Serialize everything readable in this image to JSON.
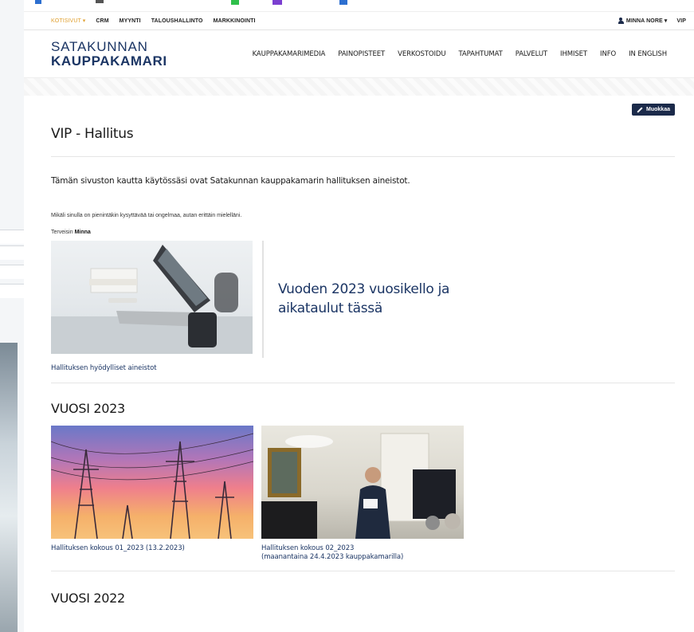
{
  "admin_bar": {
    "items": [
      "KOTISIVUT ▾",
      "CRM",
      "MYYNTI",
      "TALOUSHALLINTO",
      "MARKKINOINTI"
    ],
    "user": "MINNA NORE ▾",
    "vip": "VIP"
  },
  "logo": {
    "line1": "SATAKUNNAN",
    "line2": "KAUPPAKAMARI"
  },
  "nav": [
    "KAUPPAKAMARIMEDIA",
    "PAINOPISTEET",
    "VERKOSTOIDU",
    "TAPAHTUMAT",
    "PALVELUT",
    "IHMISET",
    "INFO",
    "IN ENGLISH"
  ],
  "edit_button": "Muokkaa",
  "page_title": "VIP - Hallitus",
  "intro": "Tämän sivuston kautta käytössäsi ovat Satakunnan kauppakamarin hallituksen aineistot.",
  "help_text": "Mikäli sinulla on pienintäkin kysyttävää tai ongelmaa, autan erittäin mielelläni.",
  "greeting": {
    "prefix": "Terveisin ",
    "name": "Minna"
  },
  "feature": {
    "text": "Vuoden 2023 vuosikello ja aikataulut tässä",
    "caption": "Hallituksen hyödylliset aineistot"
  },
  "years": [
    {
      "title": "VUOSI 2023",
      "cards": [
        {
          "caption": "Hallituksen kokous 01_2023 (13.2.2023)"
        },
        {
          "caption_line1": "Hallituksen kokous 02_2023",
          "caption_line2": "(maanantaina 24.4.2023 kauppakamarilla)"
        }
      ]
    },
    {
      "title": "VUOSI 2022"
    }
  ],
  "colors": {
    "brand_navy": "#1b3564",
    "admin_dark": "#1b2a4a",
    "home_orange": "#e0a030"
  }
}
